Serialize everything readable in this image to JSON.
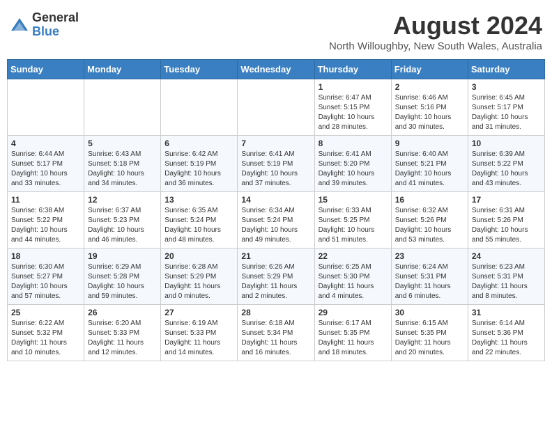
{
  "header": {
    "logo_general": "General",
    "logo_blue": "Blue",
    "title": "August 2024",
    "subtitle": "North Willoughby, New South Wales, Australia"
  },
  "weekdays": [
    "Sunday",
    "Monday",
    "Tuesday",
    "Wednesday",
    "Thursday",
    "Friday",
    "Saturday"
  ],
  "weeks": [
    [
      {
        "day": "",
        "info": ""
      },
      {
        "day": "",
        "info": ""
      },
      {
        "day": "",
        "info": ""
      },
      {
        "day": "",
        "info": ""
      },
      {
        "day": "1",
        "info": "Sunrise: 6:47 AM\nSunset: 5:15 PM\nDaylight: 10 hours and 28 minutes."
      },
      {
        "day": "2",
        "info": "Sunrise: 6:46 AM\nSunset: 5:16 PM\nDaylight: 10 hours and 30 minutes."
      },
      {
        "day": "3",
        "info": "Sunrise: 6:45 AM\nSunset: 5:17 PM\nDaylight: 10 hours and 31 minutes."
      }
    ],
    [
      {
        "day": "4",
        "info": "Sunrise: 6:44 AM\nSunset: 5:17 PM\nDaylight: 10 hours and 33 minutes."
      },
      {
        "day": "5",
        "info": "Sunrise: 6:43 AM\nSunset: 5:18 PM\nDaylight: 10 hours and 34 minutes."
      },
      {
        "day": "6",
        "info": "Sunrise: 6:42 AM\nSunset: 5:19 PM\nDaylight: 10 hours and 36 minutes."
      },
      {
        "day": "7",
        "info": "Sunrise: 6:41 AM\nSunset: 5:19 PM\nDaylight: 10 hours and 37 minutes."
      },
      {
        "day": "8",
        "info": "Sunrise: 6:41 AM\nSunset: 5:20 PM\nDaylight: 10 hours and 39 minutes."
      },
      {
        "day": "9",
        "info": "Sunrise: 6:40 AM\nSunset: 5:21 PM\nDaylight: 10 hours and 41 minutes."
      },
      {
        "day": "10",
        "info": "Sunrise: 6:39 AM\nSunset: 5:22 PM\nDaylight: 10 hours and 43 minutes."
      }
    ],
    [
      {
        "day": "11",
        "info": "Sunrise: 6:38 AM\nSunset: 5:22 PM\nDaylight: 10 hours and 44 minutes."
      },
      {
        "day": "12",
        "info": "Sunrise: 6:37 AM\nSunset: 5:23 PM\nDaylight: 10 hours and 46 minutes."
      },
      {
        "day": "13",
        "info": "Sunrise: 6:35 AM\nSunset: 5:24 PM\nDaylight: 10 hours and 48 minutes."
      },
      {
        "day": "14",
        "info": "Sunrise: 6:34 AM\nSunset: 5:24 PM\nDaylight: 10 hours and 49 minutes."
      },
      {
        "day": "15",
        "info": "Sunrise: 6:33 AM\nSunset: 5:25 PM\nDaylight: 10 hours and 51 minutes."
      },
      {
        "day": "16",
        "info": "Sunrise: 6:32 AM\nSunset: 5:26 PM\nDaylight: 10 hours and 53 minutes."
      },
      {
        "day": "17",
        "info": "Sunrise: 6:31 AM\nSunset: 5:26 PM\nDaylight: 10 hours and 55 minutes."
      }
    ],
    [
      {
        "day": "18",
        "info": "Sunrise: 6:30 AM\nSunset: 5:27 PM\nDaylight: 10 hours and 57 minutes."
      },
      {
        "day": "19",
        "info": "Sunrise: 6:29 AM\nSunset: 5:28 PM\nDaylight: 10 hours and 59 minutes."
      },
      {
        "day": "20",
        "info": "Sunrise: 6:28 AM\nSunset: 5:29 PM\nDaylight: 11 hours and 0 minutes."
      },
      {
        "day": "21",
        "info": "Sunrise: 6:26 AM\nSunset: 5:29 PM\nDaylight: 11 hours and 2 minutes."
      },
      {
        "day": "22",
        "info": "Sunrise: 6:25 AM\nSunset: 5:30 PM\nDaylight: 11 hours and 4 minutes."
      },
      {
        "day": "23",
        "info": "Sunrise: 6:24 AM\nSunset: 5:31 PM\nDaylight: 11 hours and 6 minutes."
      },
      {
        "day": "24",
        "info": "Sunrise: 6:23 AM\nSunset: 5:31 PM\nDaylight: 11 hours and 8 minutes."
      }
    ],
    [
      {
        "day": "25",
        "info": "Sunrise: 6:22 AM\nSunset: 5:32 PM\nDaylight: 11 hours and 10 minutes."
      },
      {
        "day": "26",
        "info": "Sunrise: 6:20 AM\nSunset: 5:33 PM\nDaylight: 11 hours and 12 minutes."
      },
      {
        "day": "27",
        "info": "Sunrise: 6:19 AM\nSunset: 5:33 PM\nDaylight: 11 hours and 14 minutes."
      },
      {
        "day": "28",
        "info": "Sunrise: 6:18 AM\nSunset: 5:34 PM\nDaylight: 11 hours and 16 minutes."
      },
      {
        "day": "29",
        "info": "Sunrise: 6:17 AM\nSunset: 5:35 PM\nDaylight: 11 hours and 18 minutes."
      },
      {
        "day": "30",
        "info": "Sunrise: 6:15 AM\nSunset: 5:35 PM\nDaylight: 11 hours and 20 minutes."
      },
      {
        "day": "31",
        "info": "Sunrise: 6:14 AM\nSunset: 5:36 PM\nDaylight: 11 hours and 22 minutes."
      }
    ]
  ]
}
